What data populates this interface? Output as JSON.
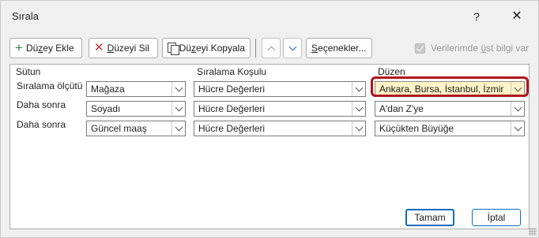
{
  "window": {
    "title": "Sırala",
    "help_label": "?",
    "close_label": "✕"
  },
  "toolbar": {
    "add_level": {
      "prefix": "Dü",
      "accel": "z",
      "suffix": "ey Ekle"
    },
    "delete_level": {
      "accel": "D",
      "suffix": "üzeyi Sil"
    },
    "copy_level": {
      "prefix": "Dü",
      "accel": "z",
      "suffix": "eyi Kopyala"
    },
    "options": {
      "accel": "S",
      "suffix": "eçenekler..."
    },
    "header_option": {
      "prefix": "Verilerimde ",
      "accel": "ü",
      "suffix": "st bilgi var",
      "checked": true
    }
  },
  "columns": {
    "column": "Sütun",
    "sort_on": "Sıralama Koşulu",
    "order": "Düzen"
  },
  "rows": [
    {
      "label": "Sıralama ölçütü",
      "column": "Mağaza",
      "sort_on": "Hücre Değerleri",
      "order": "Ankara, Bursa, İstanbul, İzmir",
      "highlighted": true
    },
    {
      "label": "Daha sonra",
      "column": "Soyadı",
      "sort_on": "Hücre Değerleri",
      "order": "A'dan Z'ye",
      "highlighted": false
    },
    {
      "label": "Daha sonra",
      "column": "Güncel maaş",
      "sort_on": "Hücre Değerleri",
      "order": "Küçükten Büyüğe",
      "highlighted": false
    }
  ],
  "footer": {
    "ok_label": "Tamam",
    "cancel_label": "İptal"
  },
  "colors": {
    "accent": "#0f6cbd",
    "highlight_ring": "#b0151b",
    "highlight_fill": "#fdf4c8"
  }
}
